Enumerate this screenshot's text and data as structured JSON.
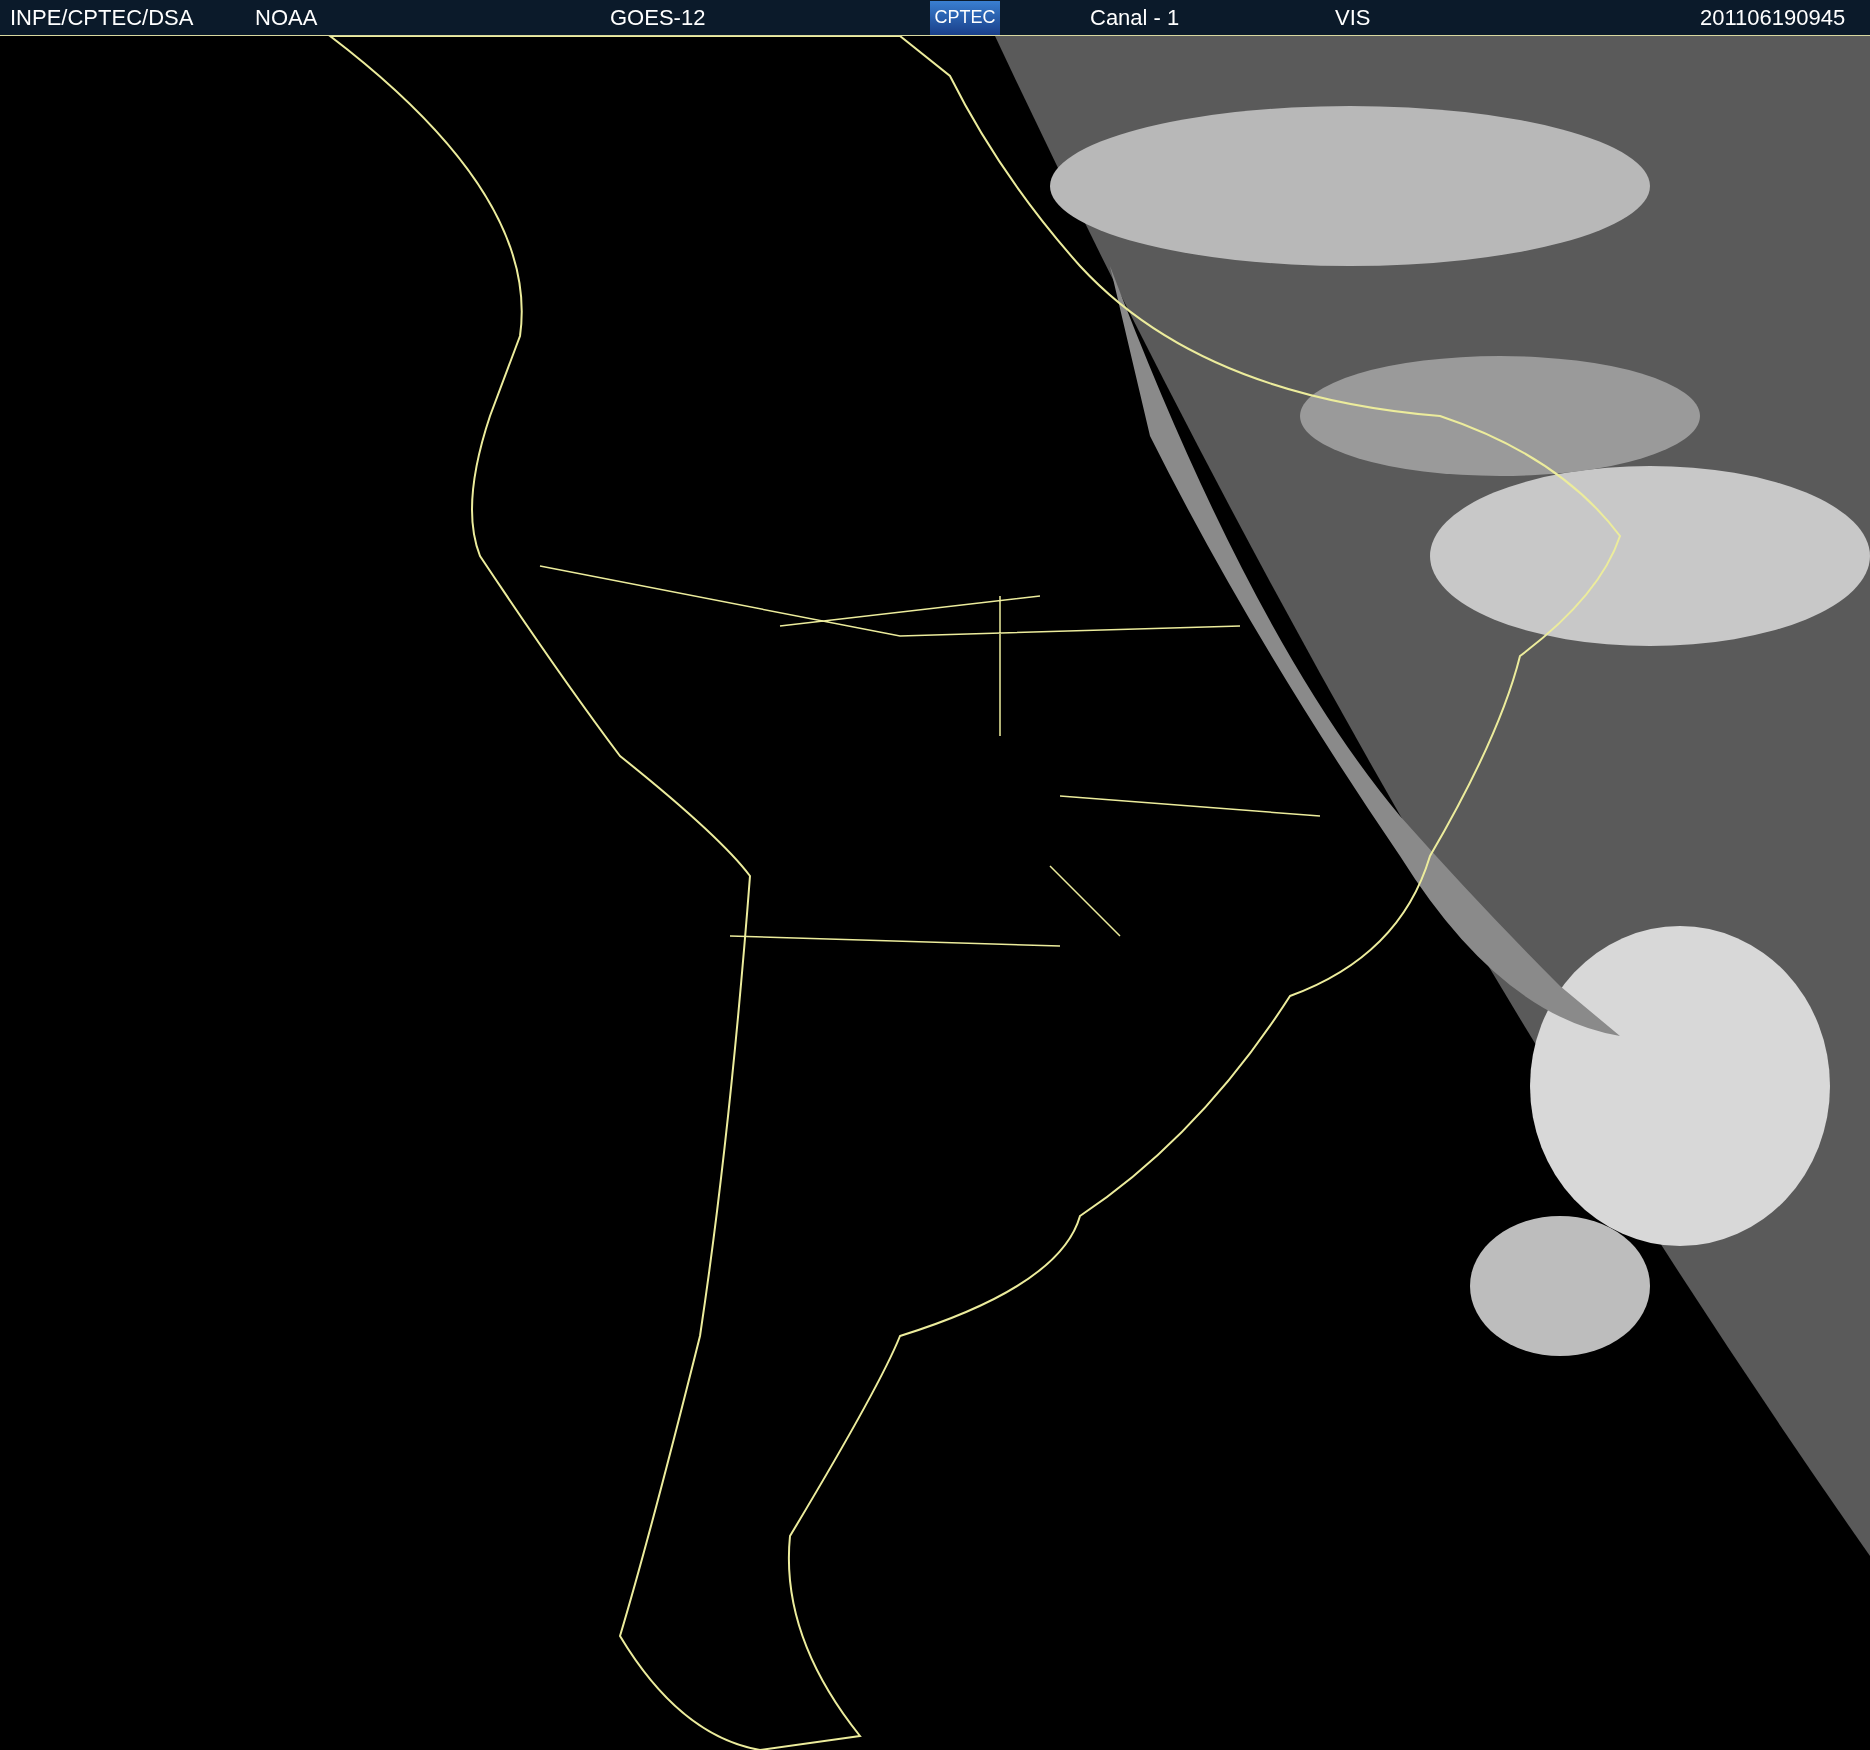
{
  "header": {
    "source": "INPE/CPTEC/DSA",
    "agency": "NOAA",
    "satellite": "GOES-12",
    "logo": "CPTEC",
    "channel": "Canal - 1",
    "band": "VIS",
    "timestamp": "201106190945"
  }
}
